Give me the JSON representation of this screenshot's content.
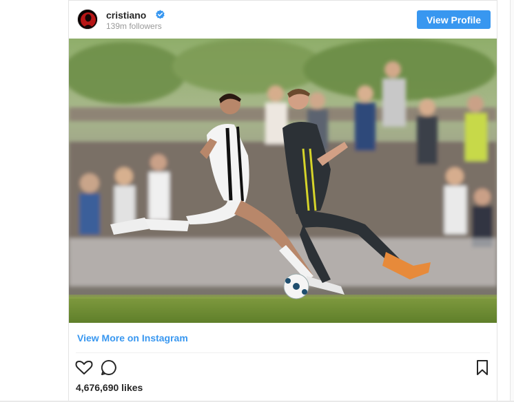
{
  "post": {
    "username": "cristiano",
    "followers": "139m followers",
    "view_profile_label": "View Profile",
    "view_more_label": "View More on Instagram",
    "likes": "4,676,690 likes"
  },
  "colors": {
    "accent": "#3897f0",
    "text": "#262626",
    "muted": "#999999"
  },
  "icons": [
    "verified-badge-icon",
    "heart-icon",
    "comment-icon",
    "bookmark-icon"
  ]
}
